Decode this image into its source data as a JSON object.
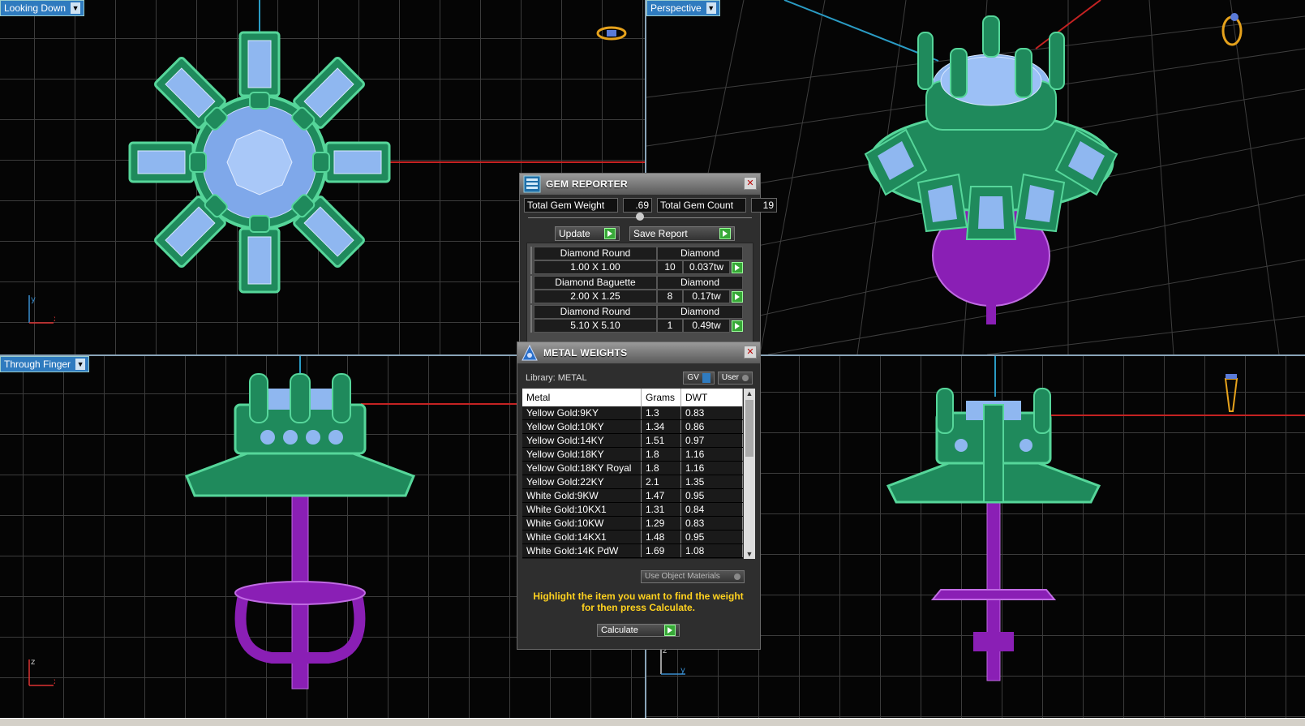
{
  "viewports": {
    "top_left": {
      "label": "Looking Down",
      "axis_v": "y",
      "axis_h": "x"
    },
    "top_right": {
      "label": "Perspective"
    },
    "bottom_left": {
      "label": "Through Finger",
      "axis_v": "z",
      "axis_h": "x"
    },
    "bottom_right": {
      "axis_v": "z",
      "axis_h": "y"
    }
  },
  "gem_reporter": {
    "title": "GEM REPORTER",
    "total_weight_label": "Total Gem Weight",
    "total_weight_value": ".69",
    "total_count_label": "Total Gem Count",
    "total_count_value": "19",
    "update_label": "Update",
    "save_label": "Save Report",
    "gems": [
      {
        "name": "Diamond Round",
        "size": "1.00 X 1.00",
        "material": "Diamond",
        "count": "10",
        "weight": "0.037tw"
      },
      {
        "name": "Diamond Baguette",
        "size": "2.00 X 1.25",
        "material": "Diamond",
        "count": "8",
        "weight": "0.17tw"
      },
      {
        "name": "Diamond Round",
        "size": "5.10 X 5.10",
        "material": "Diamond",
        "count": "1",
        "weight": "0.49tw"
      }
    ]
  },
  "metal_weights": {
    "title": "METAL WEIGHTS",
    "library_label": "Library: METAL",
    "gv_label": "GV",
    "user_label": "User",
    "columns": [
      "Metal",
      "Grams",
      "DWT"
    ],
    "rows": [
      [
        "Yellow Gold:9KY",
        "1.3",
        "0.83"
      ],
      [
        "Yellow Gold:10KY",
        "1.34",
        "0.86"
      ],
      [
        "Yellow Gold:14KY",
        "1.51",
        "0.97"
      ],
      [
        "Yellow Gold:18KY",
        "1.8",
        "1.16"
      ],
      [
        "Yellow Gold:18KY Royal",
        "1.8",
        "1.16"
      ],
      [
        "Yellow Gold:22KY",
        "2.1",
        "1.35"
      ],
      [
        "White Gold:9KW",
        "1.47",
        "0.95"
      ],
      [
        "White Gold:10KX1",
        "1.31",
        "0.84"
      ],
      [
        "White Gold:10KW",
        "1.29",
        "0.83"
      ],
      [
        "White Gold:14KX1",
        "1.48",
        "0.95"
      ],
      [
        "White Gold:14K PdW",
        "1.69",
        "1.08"
      ]
    ],
    "use_object_materials_label": "Use Object Materials",
    "message": "Highlight the item you want to find the weight for then press Calculate.",
    "calculate_label": "Calculate"
  },
  "colors": {
    "metal_green": "#1f8a5c",
    "gem_blue": "#8fb7f0",
    "post_purple": "#8a1fb5",
    "viewport_label": "#2f7bbf",
    "message_yellow": "#ffd21f"
  }
}
